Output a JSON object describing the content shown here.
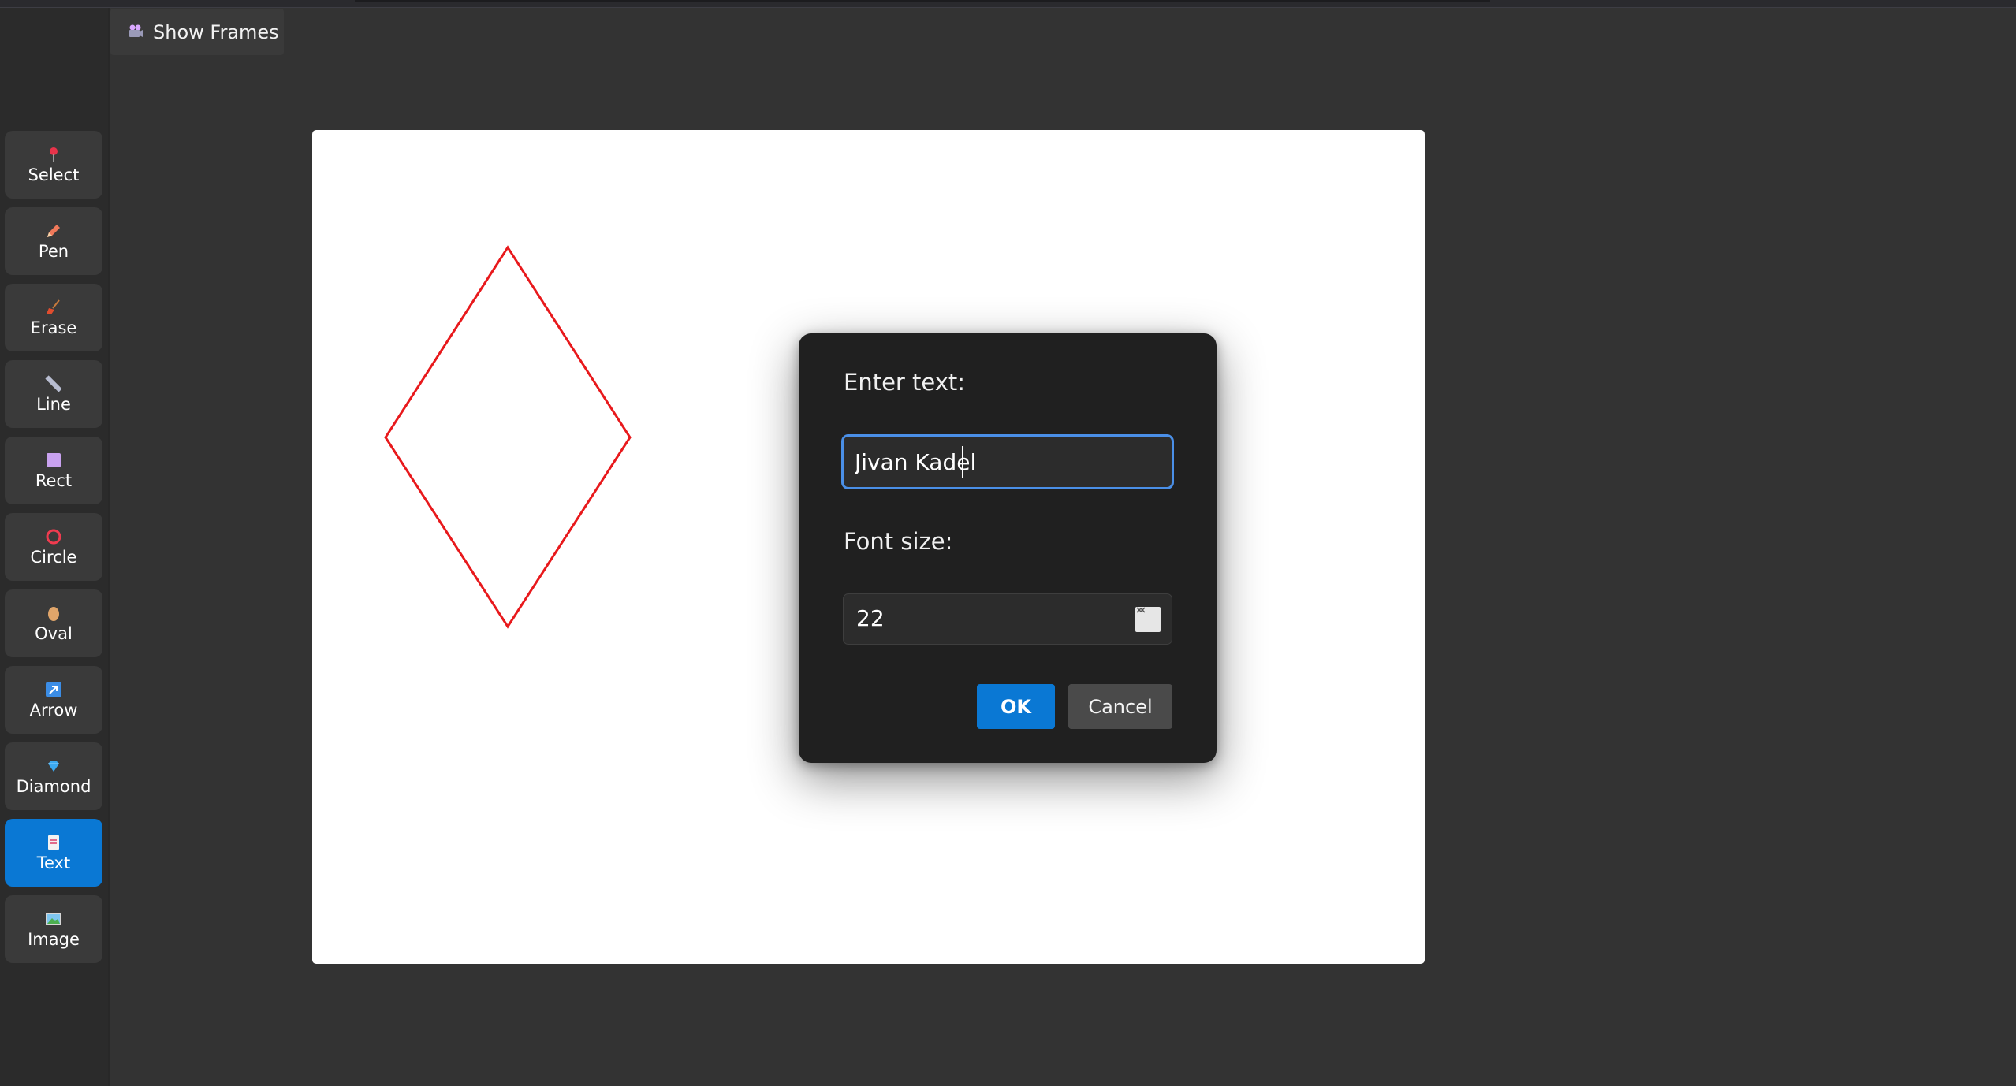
{
  "toolbar": {
    "show_frames_label": "Show Frames",
    "tools": [
      {
        "id": "select",
        "label": "Select",
        "icon": "pushpin-icon"
      },
      {
        "id": "pen",
        "label": "Pen",
        "icon": "pencil-icon"
      },
      {
        "id": "erase",
        "label": "Erase",
        "icon": "broom-icon"
      },
      {
        "id": "line",
        "label": "Line",
        "icon": "ruler-icon"
      },
      {
        "id": "rect",
        "label": "Rect",
        "icon": "square-icon"
      },
      {
        "id": "circle",
        "label": "Circle",
        "icon": "circle-icon"
      },
      {
        "id": "oval",
        "label": "Oval",
        "icon": "egg-icon"
      },
      {
        "id": "arrow",
        "label": "Arrow",
        "icon": "arrow-icon"
      },
      {
        "id": "diamond",
        "label": "Diamond",
        "icon": "gem-icon"
      },
      {
        "id": "text",
        "label": "Text",
        "icon": "document-icon",
        "active": true
      },
      {
        "id": "image",
        "label": "Image",
        "icon": "picture-icon"
      }
    ]
  },
  "canvas": {
    "shapes": [
      {
        "type": "diamond",
        "stroke": "#e8191c"
      }
    ]
  },
  "dialog": {
    "text_label": "Enter text:",
    "text_value": "Jivan Kadel",
    "font_size_label": "Font size:",
    "font_size_value": "22",
    "ok_label": "OK",
    "cancel_label": "Cancel"
  },
  "colors": {
    "accent": "#0a78d4",
    "background": "#333333",
    "button": "#3a3a3a",
    "dialog": "#202020",
    "diamond_stroke": "#e8191c"
  }
}
